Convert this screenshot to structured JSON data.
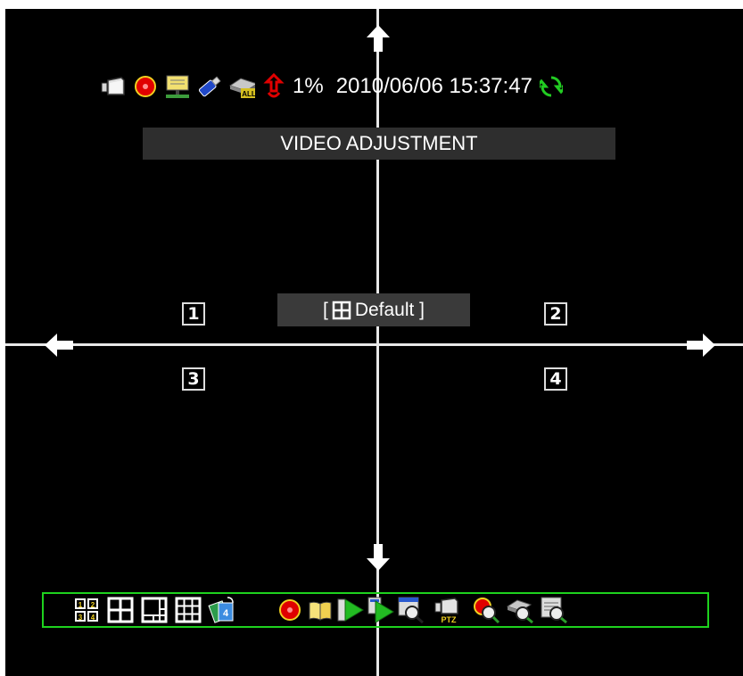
{
  "status": {
    "hdd_usage": "1%",
    "datetime": "2010/06/06 15:37:47"
  },
  "title": "VIDEO ADJUSTMENT",
  "mode_label": {
    "open": "[",
    "text": "Default ]"
  },
  "channels": [
    "1",
    "2",
    "3",
    "4"
  ],
  "toolbar": {
    "buttons": [
      "layout-quad-numbered",
      "layout-quad",
      "layout-pip",
      "layout-nine",
      "sequence-1-4",
      "record",
      "manual",
      "playback",
      "playback-files",
      "snapshot-search",
      "ptz",
      "record-search",
      "device-search",
      "log-search"
    ],
    "ptz_text": "PTZ"
  },
  "colors": {
    "border": "#1ed21e",
    "background": "#000000",
    "divider": "#e8e8e8",
    "record_red": "#e00000",
    "icon_yellow": "#f0d020",
    "refresh_green": "#22cc22"
  }
}
